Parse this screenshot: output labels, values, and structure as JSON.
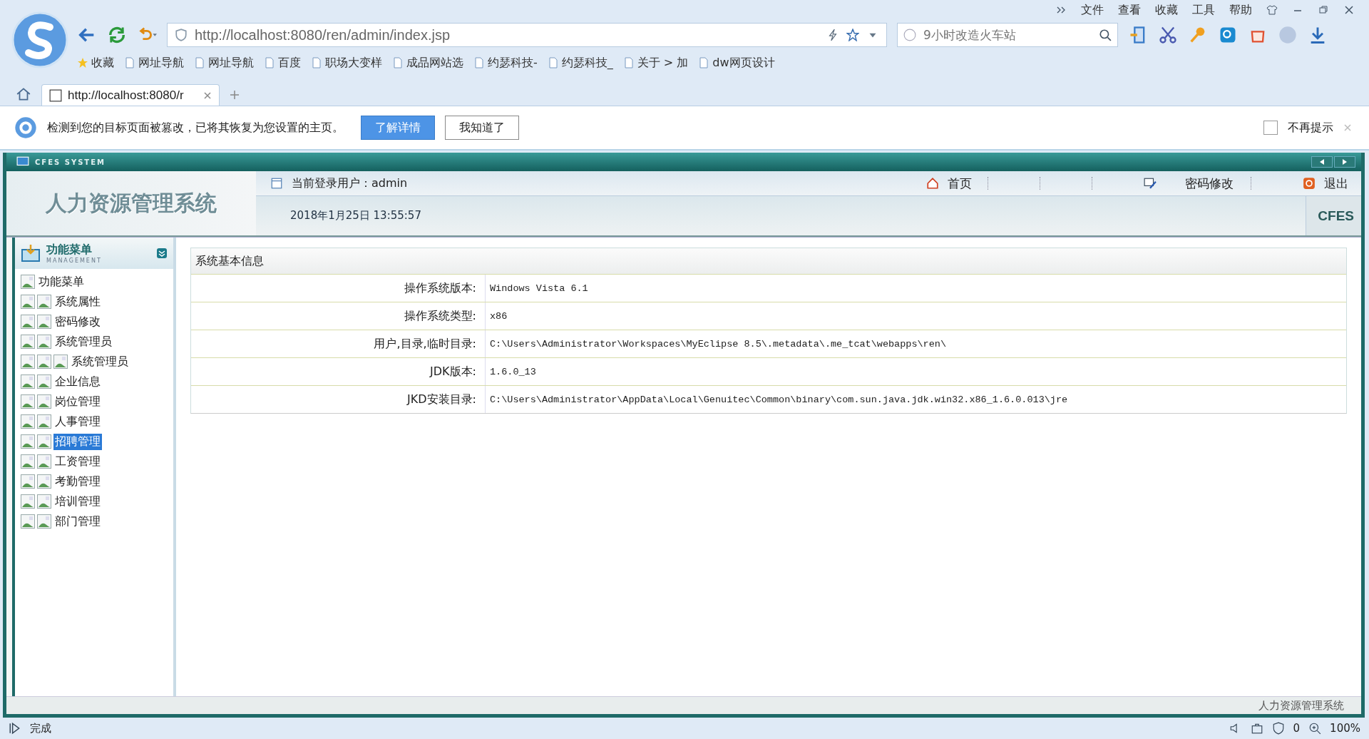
{
  "browser": {
    "menu": [
      "文件",
      "查看",
      "收藏",
      "工具",
      "帮助"
    ],
    "address": "http://localhost:8080/ren/admin/index.jsp",
    "search": {
      "placeholder": "9小时改造火车站"
    },
    "bookmarks": [
      "收藏",
      "网址导航",
      "网址导航",
      "百度",
      "职场大变样",
      "成品网站选",
      "约瑟科技-",
      "约瑟科技_",
      "关于 > 加",
      "dw网页设计"
    ],
    "tabs": [
      {
        "title": "http://localhost:8080/r",
        "selected": true
      }
    ],
    "notice": {
      "text": "检测到您的目标页面被篡改，已将其恢复为您设置的主页。",
      "buttons": [
        "了解详情",
        "我知道了"
      ],
      "dont_show": {
        "label": "不再提示",
        "checked": false
      }
    },
    "status": {
      "text": "完成",
      "count": "0",
      "zoom": "100%"
    }
  },
  "app": {
    "frame_title": "CFES SYSTEM",
    "header_title": "人力资源管理系统",
    "user": "当前登录用户：admin",
    "datetime": "2018年1月25日  13:55:57",
    "nav": [
      "首页",
      "密码修改",
      "退出"
    ],
    "badge": "CFES",
    "menu_title": "功能菜单",
    "menu_subtitle": "MANAGEMENT",
    "tree": {
      "label": "功能菜单",
      "selected": false,
      "children": [
        {
          "label": "系统属性",
          "selected": false
        },
        {
          "label": "密码修改",
          "selected": false
        },
        {
          "label": "系统管理员",
          "selected": false,
          "children": [
            {
              "label": "系统管理员",
              "selected": false
            }
          ]
        },
        {
          "label": "企业信息",
          "selected": false
        },
        {
          "label": "岗位管理",
          "selected": false
        },
        {
          "label": "人事管理",
          "selected": false
        },
        {
          "label": "招聘管理",
          "selected": true
        },
        {
          "label": "工资管理",
          "selected": false
        },
        {
          "label": "考勤管理",
          "selected": false
        },
        {
          "label": "培训管理",
          "selected": false
        },
        {
          "label": "部门管理",
          "selected": false
        }
      ]
    },
    "info": {
      "title": "系统基本信息",
      "rows": [
        {
          "label": "操作系统版本:",
          "value": "Windows Vista   6.1"
        },
        {
          "label": "操作系统类型:",
          "value": "x86"
        },
        {
          "label": "用户,目录,临时目录:",
          "value": "C:\\Users\\Administrator\\Workspaces\\MyEclipse 8.5\\.metadata\\.me_tcat\\webapps\\ren\\"
        },
        {
          "label": "JDK版本:",
          "value": "1.6.0_13"
        },
        {
          "label": "JKD安装目录:",
          "value": "C:\\Users\\Administrator\\AppData\\Local\\Genuitec\\Common\\binary\\com.sun.java.jdk.win32.x86_1.6.0.013\\jre"
        }
      ]
    },
    "footer": "人力资源管理系统"
  }
}
